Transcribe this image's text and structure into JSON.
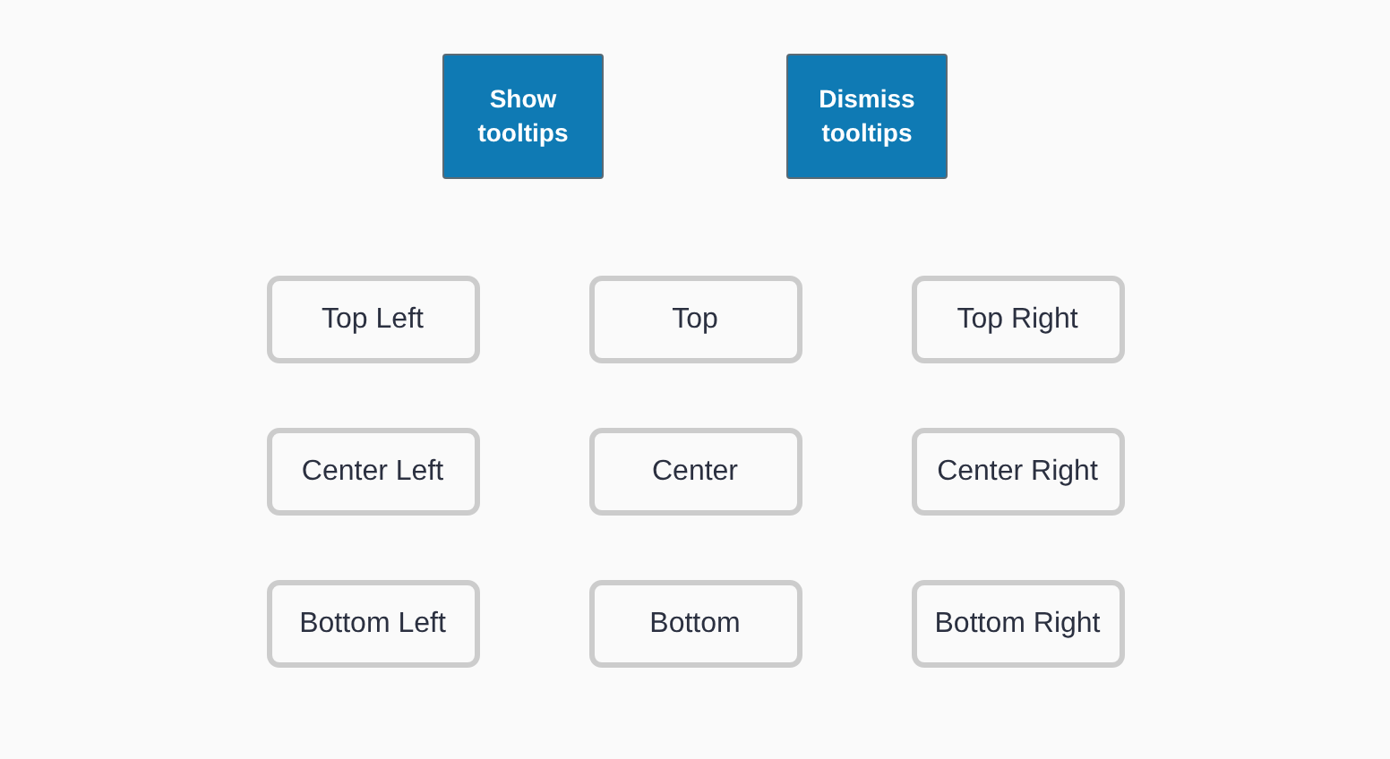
{
  "actions": [
    {
      "label": "Show tooltips"
    },
    {
      "label": "Dismiss tooltips"
    }
  ],
  "positions": [
    {
      "label": "Top Left"
    },
    {
      "label": "Top"
    },
    {
      "label": "Top Right"
    },
    {
      "label": "Center Left"
    },
    {
      "label": "Center"
    },
    {
      "label": "Center Right"
    },
    {
      "label": "Bottom Left"
    },
    {
      "label": "Bottom"
    },
    {
      "label": "Bottom Right"
    }
  ]
}
